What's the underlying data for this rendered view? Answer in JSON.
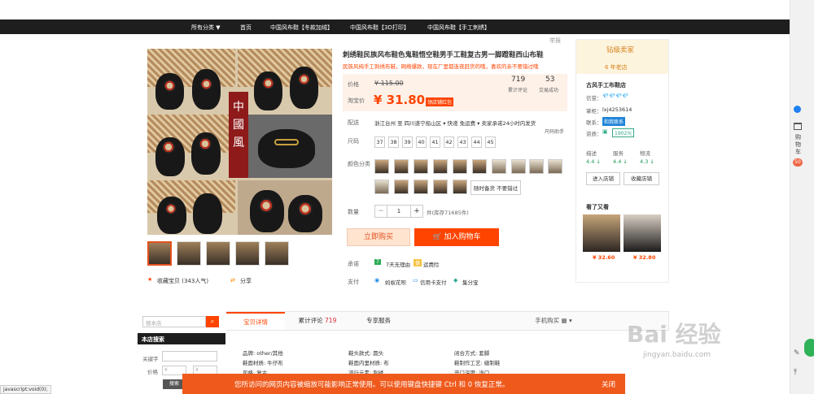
{
  "nav": {
    "all_cat": "所有分类 ▼",
    "home": "首页",
    "item1": "中国风布鞋【冬款加绒】",
    "item2": "中国风布鞋【3D打印】",
    "item3": "中国风布鞋【手工刺绣】"
  },
  "product": {
    "report": "举报",
    "title": "刺绣鞋民族风布鞋色鬼鞋悟空鞋男手工鞋复古男一脚蹬鞋西山布鞋",
    "subtitle": "民族风纯手工刺绣布鞋，网络爆款，现在厂里都连夜赶货的哦，喜欢的亲不要错过哦",
    "banner_text": "中國風",
    "price_label": "价格",
    "orig_price": "¥ 115.00",
    "promo_label": "淘宝价",
    "promo_price": "¥ 31.80",
    "coupon": "领店铺红包",
    "reviews_num": "719",
    "reviews_label": "累计评论",
    "deals_num": "53",
    "deals_label": "交易成功",
    "ship_label": "配送",
    "ship_text": "浙江台州 至  四川遂宁船山区 ▾  快递 免运费 ▾  卖家承诺24小时内发货",
    "ship_help": "尺码助手",
    "size_label": "尺码",
    "sizes": [
      "37",
      "38",
      "39",
      "40",
      "41",
      "42",
      "43",
      "44",
      "45"
    ],
    "color_label": "颜色分类",
    "random_text": "随时备货 不要错过",
    "qty_label": "数量",
    "qty_value": "1",
    "stock": "件(库存71685件)",
    "buy_now": "立即购买",
    "add_cart": "加入购物车",
    "promise_label": "承诺",
    "promise1": "7天无理由",
    "promise2": "运费险",
    "pay_label": "支付",
    "pay1": "蚂蚁花呗",
    "pay2": "信用卡支付",
    "pay3": "集分宝",
    "fav": "收藏宝贝 (343人气)",
    "share": "分享"
  },
  "shop": {
    "badge": "钻级卖家",
    "years": "6 年老店",
    "name": "古风手工布鞋店",
    "credit_label": "信誉：",
    "credit_value": "💎💎💎💎",
    "contact_label": "掌柜：",
    "contact_value": "lxj4253614",
    "chat_label": "联系：",
    "chat_value": "和我联系",
    "qual_label": "资质：",
    "qual_value": "1902元",
    "score_labels": [
      "描述",
      "服务",
      "物流"
    ],
    "score_values": [
      "4.4 ↓",
      "4.4 ↓",
      "4.3 ↓"
    ],
    "enter_shop": "进入店铺",
    "fav_shop": "收藏店铺",
    "also_see": "看了又看",
    "rec_prices": [
      "¥ 32.60",
      "¥ 32.80"
    ]
  },
  "sidebar": {
    "search_placeholder": "搜本店",
    "shop_search": "本店搜索",
    "keyword_label": "关键字",
    "price_label": "价格",
    "price_from": "¥",
    "price_to": "¥",
    "search_btn": "搜索"
  },
  "tabs": {
    "details": "宝贝详情",
    "reviews": "累计评论",
    "reviews_count": "719",
    "service": "专享服务",
    "mobile": "手机购买 ▦ ▾"
  },
  "attrs": [
    "品牌: other/其他",
    "鞋头款式: 圆头",
    "闭合方式: 套脚",
    "鞋面材质: 牛仔布",
    "鞋面内里材质: 布",
    "鞋制作工艺: 缝制鞋",
    "风格: 复古",
    "流行元素: 刺绣",
    "开口深度: 浅口"
  ],
  "notice": {
    "text": "您所访问的网页内容被缩放可能影响正常使用。可以使用键盘快捷键 Ctrl 和 0 恢复正常。",
    "close": "关闭"
  },
  "status": "javascript:void(0);",
  "right": {
    "cart": "购物车",
    "cart_count": "50"
  },
  "watermark": "Bai 经验",
  "watermark_url": "jingyan.baidu.com"
}
